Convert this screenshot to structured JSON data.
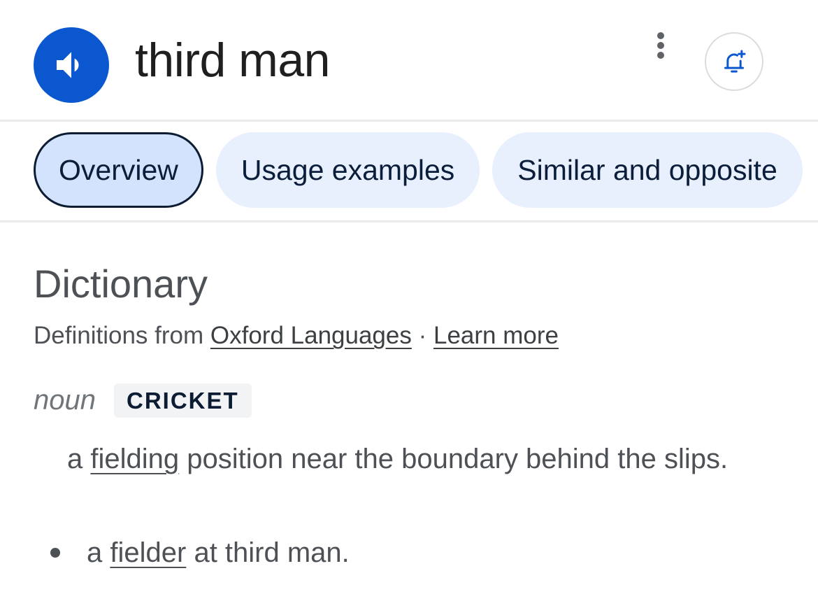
{
  "header": {
    "word": "third man"
  },
  "tabs": [
    {
      "label": "Overview",
      "active": true
    },
    {
      "label": "Usage examples",
      "active": false
    },
    {
      "label": "Similar and opposite",
      "active": false
    }
  ],
  "dictionary": {
    "heading": "Dictionary",
    "source_prefix": "Definitions from",
    "source_link": "Oxford Languages",
    "separator": "·",
    "learn_more": "Learn more",
    "part_of_speech": "noun",
    "label": "CRICKET",
    "definition": {
      "part1": "a",
      "link": "fielding",
      "part2": "position near the boundary behind the slips."
    },
    "example": {
      "part1": "a",
      "link": "fielder",
      "part2": "at third man."
    }
  },
  "colors": {
    "accent": "#0b57d0",
    "tab_active_bg": "#d3e3fd",
    "tab_bg": "#e8effd",
    "text_secondary": "#4d5156"
  },
  "icons": {
    "speaker": "speaker-icon",
    "more": "more-vert-icon",
    "bell": "bell-plus-icon"
  }
}
